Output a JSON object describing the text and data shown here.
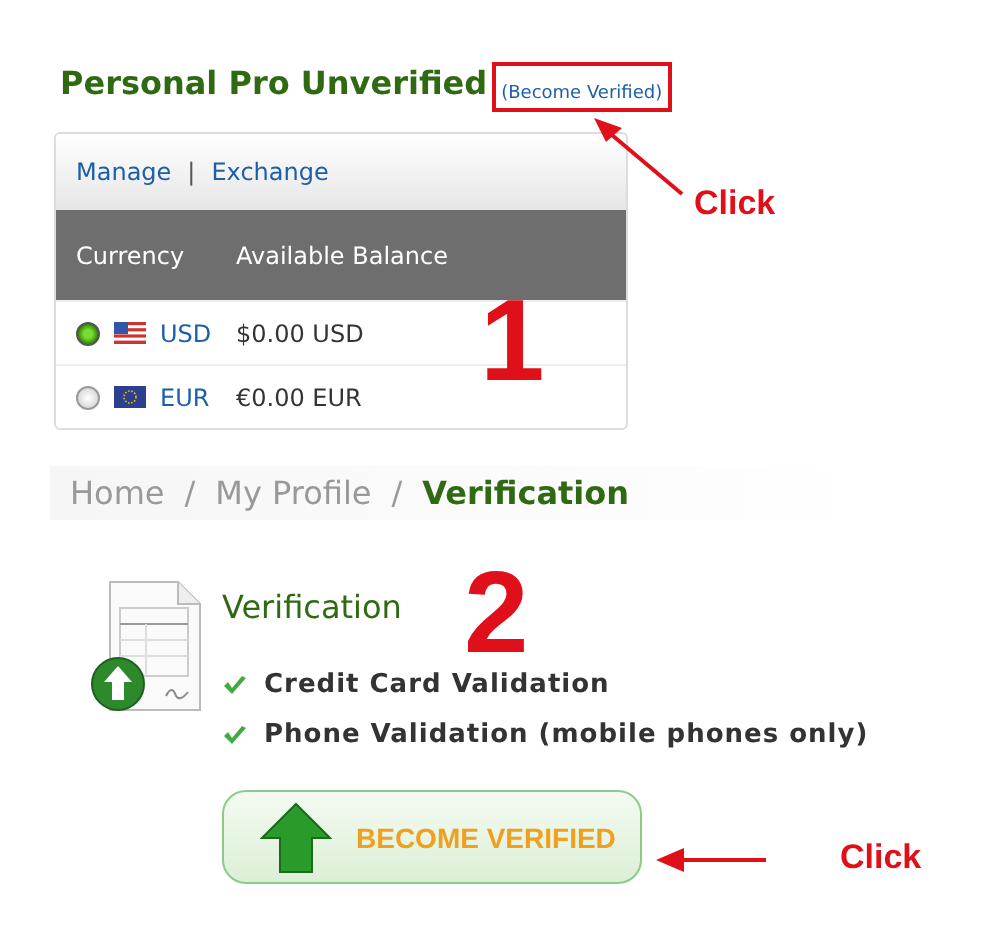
{
  "account": {
    "title": "Personal Pro Unverified",
    "verify_link": "(Become Verified)"
  },
  "balance_card": {
    "links": [
      "Manage",
      "Exchange"
    ],
    "separator": "|",
    "columns": [
      "Currency",
      "Available Balance"
    ],
    "rows": [
      {
        "currency": "USD",
        "balance": "$0.00 USD",
        "selected": true
      },
      {
        "currency": "EUR",
        "balance": "€0.00 EUR",
        "selected": false
      }
    ]
  },
  "breadcrumb": [
    {
      "label": "Home",
      "selected": false
    },
    {
      "label": "My Profile",
      "selected": false
    },
    {
      "label": "Verification",
      "selected": true
    }
  ],
  "breadcrumb_separator": "/",
  "verification": {
    "title": "Verification",
    "items": [
      "Credit Card Validation",
      "Phone Validation (mobile phones only)"
    ],
    "button": "BECOME VERIFIED"
  },
  "annotations": [
    {
      "kind": "step",
      "text": "1"
    },
    {
      "kind": "click",
      "text": "Click"
    },
    {
      "kind": "step",
      "text": "2"
    },
    {
      "kind": "click",
      "text": "Click"
    }
  ]
}
